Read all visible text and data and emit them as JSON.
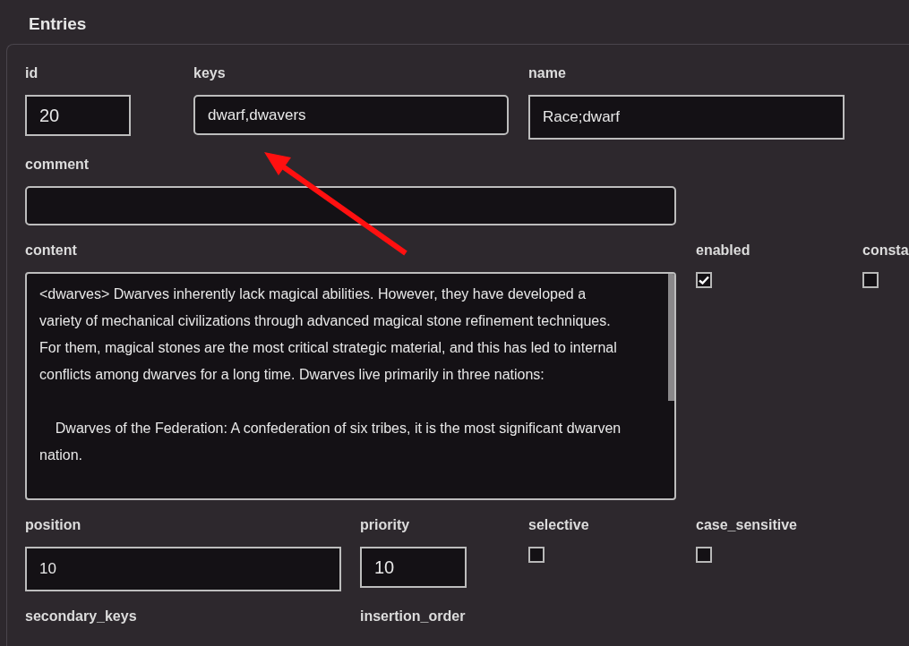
{
  "title": "Entries",
  "rows": [
    {
      "fields": [
        {
          "label": "id",
          "kind": "input",
          "value": "20"
        },
        {
          "label": "keys",
          "kind": "textarea",
          "value": "dwarf,dwavers"
        },
        {
          "label": "name",
          "kind": "input",
          "value": "Race;dwarf"
        }
      ]
    },
    {
      "fields": [
        {
          "label": "comment",
          "kind": "textarea"
        }
      ]
    },
    {
      "fields": [
        {
          "label": "content",
          "kind": "longtext",
          "value": "<dwarves> Dwarves inherently lack magical abilities. However, they have developed a variety of mechanical civilizations through advanced magical stone refinement techniques. For them, magical stones are the most critical strategic material, and this has led to internal conflicts among dwarves for a long time. Dwarves live primarily in three nations:\n\n    Dwarves of the Federation: A confederation of six tribes, it is the most significant dwarven nation."
        },
        {
          "label": "enabled",
          "kind": "checkbox",
          "checked": true
        },
        {
          "label": "consta",
          "kind": "checkbox",
          "checked": false
        }
      ]
    },
    {
      "fields": [
        {
          "label": "position",
          "kind": "input",
          "value": "10"
        },
        {
          "label": "priority",
          "kind": "input",
          "value": "10"
        },
        {
          "label": "selective",
          "kind": "checkbox",
          "checked": false
        },
        {
          "label": "case_sensitive",
          "kind": "checkbox",
          "checked": false
        }
      ]
    },
    {
      "fields": [
        {
          "label": "secondary_keys",
          "kind": "label"
        },
        {
          "label": "insertion_order",
          "kind": "label"
        }
      ]
    }
  ]
}
